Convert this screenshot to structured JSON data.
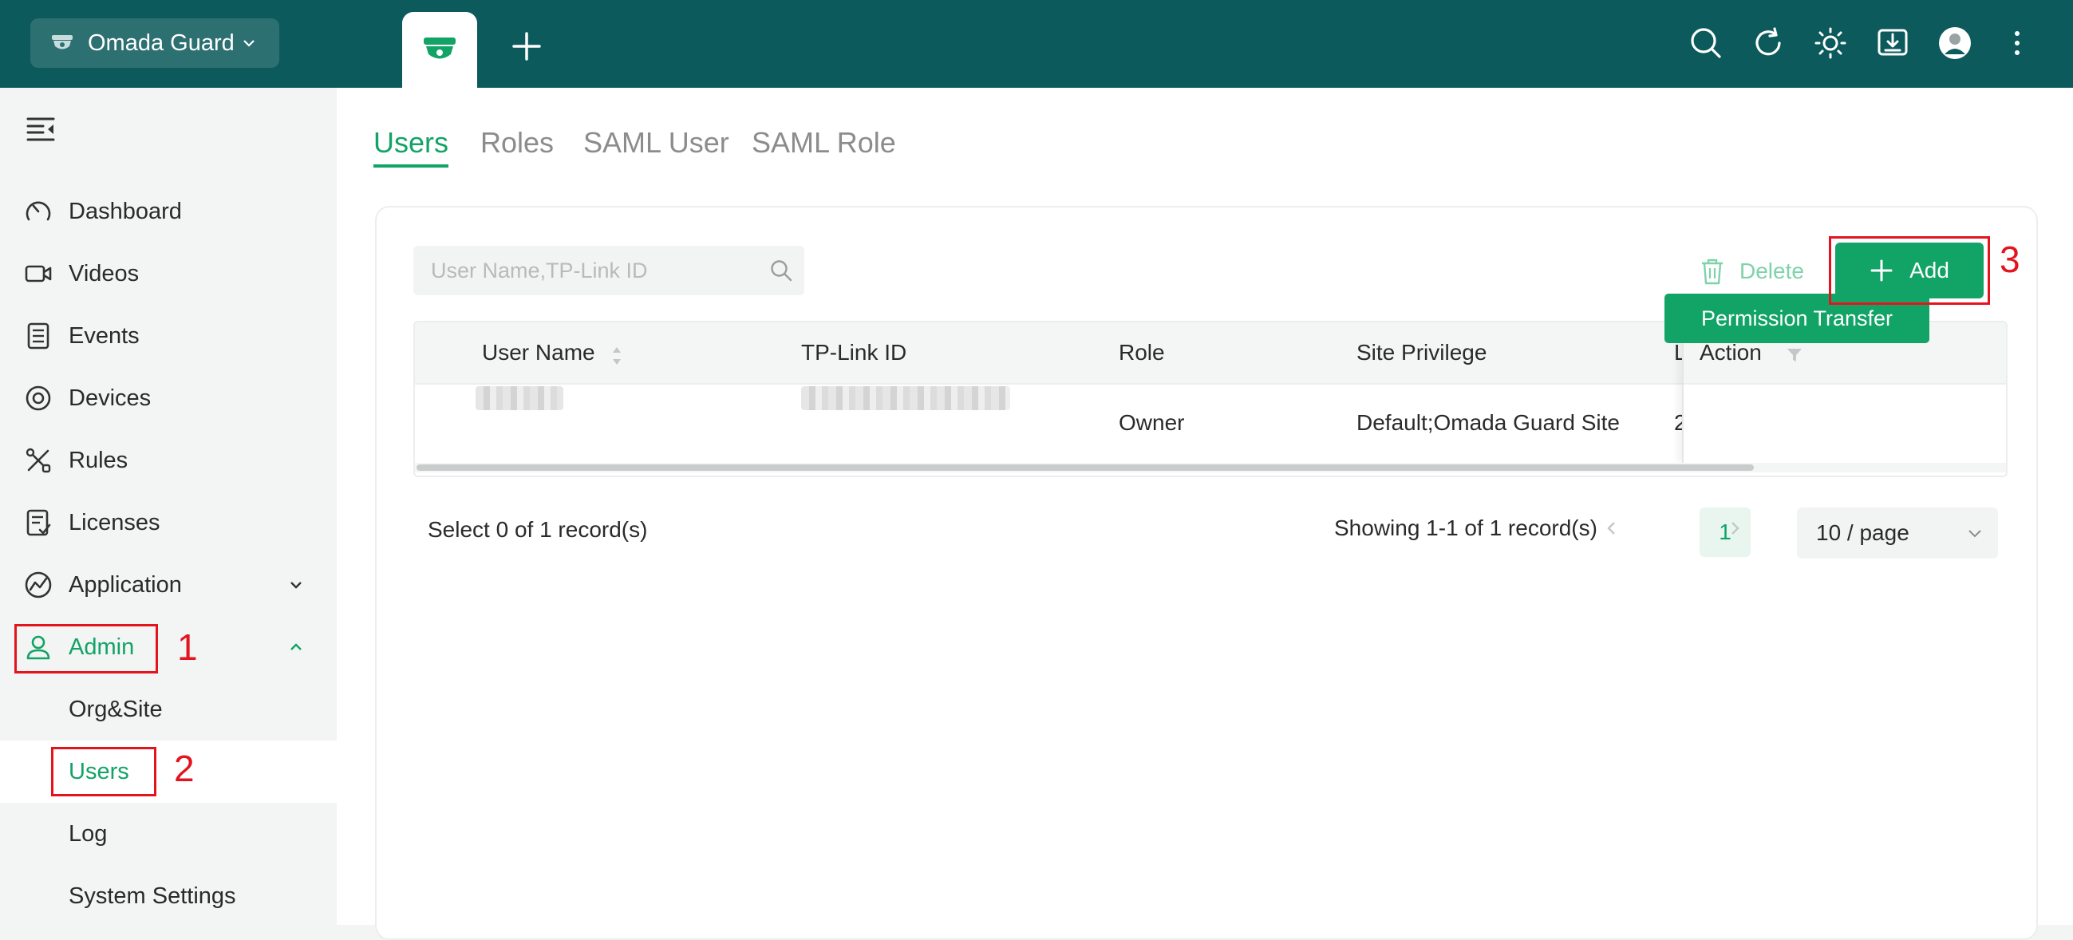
{
  "topbar": {
    "brand": "Omada Guard"
  },
  "sidebar": {
    "items": [
      {
        "label": "Dashboard"
      },
      {
        "label": "Videos"
      },
      {
        "label": "Events"
      },
      {
        "label": "Devices"
      },
      {
        "label": "Rules"
      },
      {
        "label": "Licenses"
      },
      {
        "label": "Application"
      },
      {
        "label": "Admin"
      }
    ],
    "sub_items": [
      {
        "label": "Org&Site"
      },
      {
        "label": "Users"
      },
      {
        "label": "Log"
      },
      {
        "label": "System Settings"
      }
    ]
  },
  "annotations": [
    "1",
    "2",
    "3"
  ],
  "main": {
    "tabs": [
      {
        "label": "Users"
      },
      {
        "label": "Roles"
      },
      {
        "label": "SAML User"
      },
      {
        "label": "SAML Role"
      }
    ],
    "search_placeholder": "User Name,TP-Link ID",
    "delete_label": "Delete",
    "add_label": "Add",
    "table": {
      "columns": [
        "User Name",
        "TP-Link ID",
        "Role",
        "Site Privilege",
        "L",
        "Action"
      ],
      "rows": [
        {
          "role": "Owner",
          "site_privilege": "Default;Omada Guard Site",
          "last_col": "2",
          "action": "Permission Transfer"
        }
      ]
    },
    "select_info": "Select 0 of 1 record(s)",
    "showing": "Showing 1-1 of 1 record(s)",
    "current_page": "1",
    "page_size": "10 / page"
  },
  "colors": {
    "topbar": "#0c5a5c",
    "accent": "#12a366",
    "annotation": "#e4141e"
  }
}
